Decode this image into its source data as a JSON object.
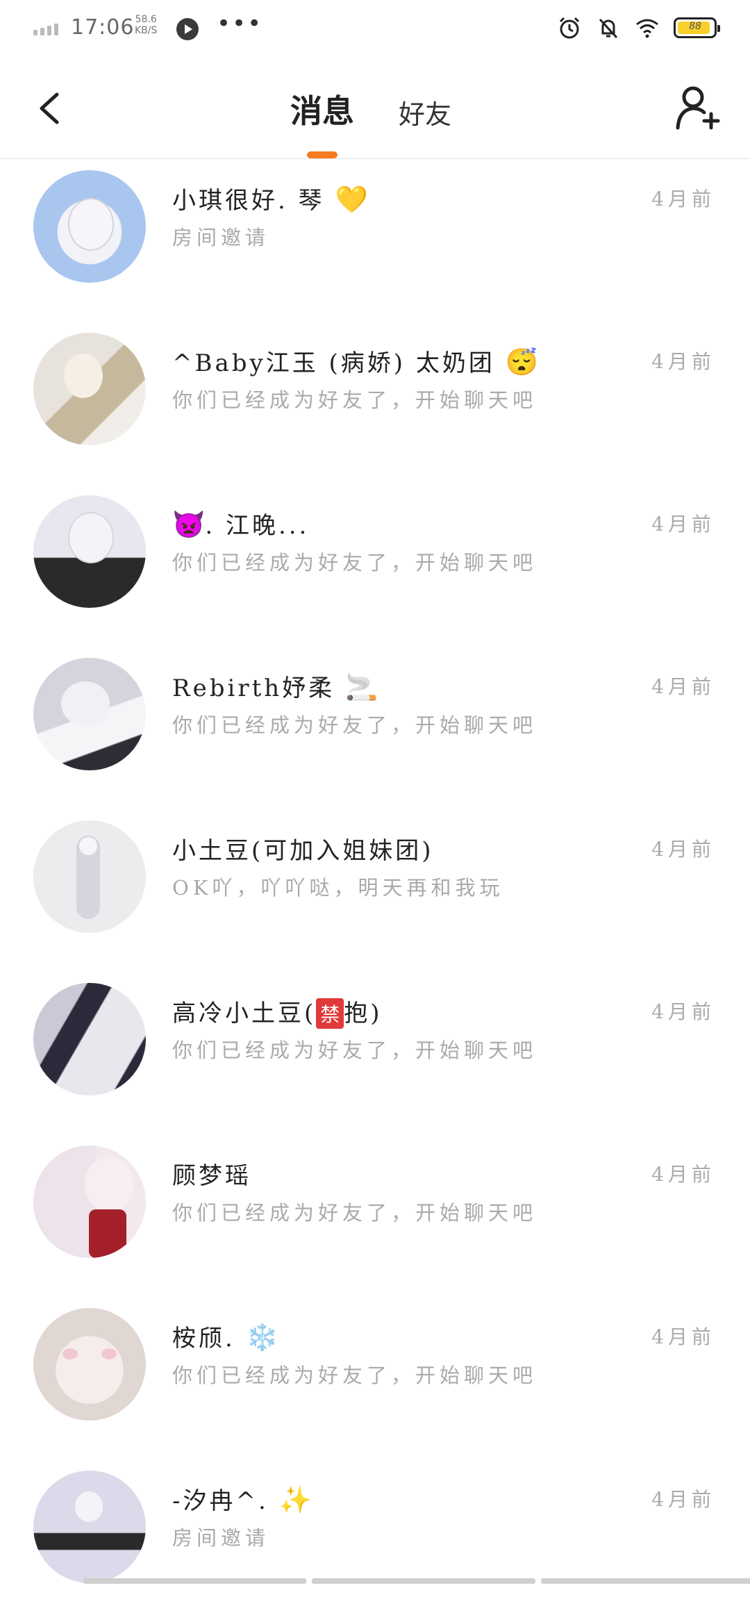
{
  "status_bar": {
    "time": "17:06",
    "net_speed_value": "58.6",
    "net_speed_unit": "KB/S",
    "more": "•••",
    "battery_level": "88"
  },
  "header": {
    "tabs": [
      {
        "label": "消息",
        "active": true
      },
      {
        "label": "好友",
        "active": false
      }
    ],
    "accent_color": "#f47b20"
  },
  "messages": [
    {
      "name": "小琪很好. 琴",
      "emoji": "💛",
      "preview": "房间邀请",
      "time": "4月前",
      "avatar_colors": [
        "#a9c6ef",
        "#eef0f6"
      ]
    },
    {
      "name": "^Baby江玉 (病娇) 太奶团",
      "emoji": "😴",
      "preview": "你们已经成为好友了，开始聊天吧",
      "time": "4月前",
      "avatar_colors": [
        "#d9d4d0",
        "#a98c5f"
      ]
    },
    {
      "name": "",
      "emoji": "👿",
      "name_suffix": ". 江晚...",
      "preview": "你们已经成为好友了，开始聊天吧",
      "time": "4月前",
      "avatar_colors": [
        "#e3e0ea",
        "#222222"
      ]
    },
    {
      "name": "Rebirth妤柔",
      "emoji": "🚬",
      "preview": "你们已经成为好友了，开始聊天吧",
      "time": "4月前",
      "avatar_colors": [
        "#d8d5dd",
        "#ffffff"
      ]
    },
    {
      "name": "小土豆(可加入姐妹团)",
      "emoji": "",
      "preview": "OK吖，吖吖哒，明天再和我玩",
      "time": "4月前",
      "avatar_colors": [
        "#ececef",
        "#c8c8d0"
      ]
    },
    {
      "name": "高冷小土豆(",
      "emoji": "",
      "badge": "禁",
      "name_suffix": "抱)",
      "preview": "你们已经成为好友了，开始聊天吧",
      "time": "4月前",
      "avatar_colors": [
        "#cfcad6",
        "#2b2a3a"
      ]
    },
    {
      "name": "顾梦瑶",
      "emoji": "",
      "preview": "你们已经成为好友了，开始聊天吧",
      "time": "4月前",
      "avatar_colors": [
        "#ece4ea",
        "#a3202a"
      ]
    },
    {
      "name": "桉颀.",
      "emoji": "❄️",
      "preview": "你们已经成为好友了，开始聊天吧",
      "time": "4月前",
      "avatar_colors": [
        "#e8e0dc",
        "#f1c8cf"
      ]
    },
    {
      "name": "-汐冉^.",
      "emoji": "✨",
      "preview": "房间邀请",
      "time": "4月前",
      "avatar_colors": [
        "#ddd9ea",
        "#222222"
      ]
    }
  ]
}
